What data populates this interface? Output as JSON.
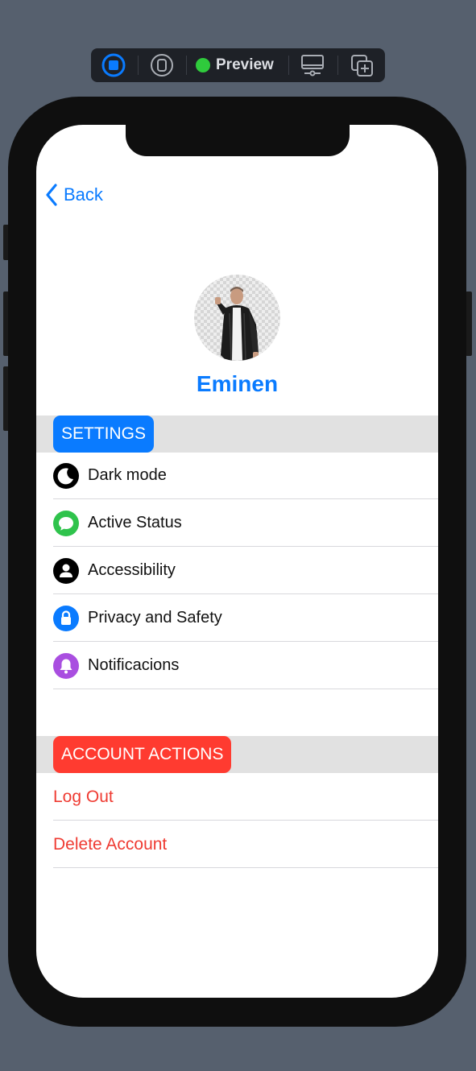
{
  "toolbar": {
    "status_label": "Preview",
    "status_color": "#2fcb3c",
    "icons": [
      "live-preview-icon",
      "variant-icon",
      "device-settings-icon",
      "duplicate-icon"
    ]
  },
  "nav": {
    "back_label": "Back",
    "tint_color": "#0a7bff"
  },
  "profile": {
    "name": "Eminen"
  },
  "settings_section": {
    "title": "SETTINGS",
    "badge_color": "#0a7bff",
    "items": [
      {
        "label": "Dark mode",
        "icon": "moon-icon",
        "icon_color": "#000000"
      },
      {
        "label": "Active Status",
        "icon": "message-bubble-icon",
        "icon_color": "#2fc34c"
      },
      {
        "label": "Accessibility",
        "icon": "person-icon",
        "icon_color": "#000000"
      },
      {
        "label": "Privacy and Safety",
        "icon": "lock-icon",
        "icon_color": "#0a7bff"
      },
      {
        "label": "Notificacions",
        "icon": "bell-icon",
        "icon_color": "#a94ee0"
      }
    ]
  },
  "account_section": {
    "title": "ACCOUNT ACTIONS",
    "badge_color": "#ff3b30",
    "items": [
      {
        "label": "Log Out"
      },
      {
        "label": "Delete Account"
      }
    ]
  }
}
